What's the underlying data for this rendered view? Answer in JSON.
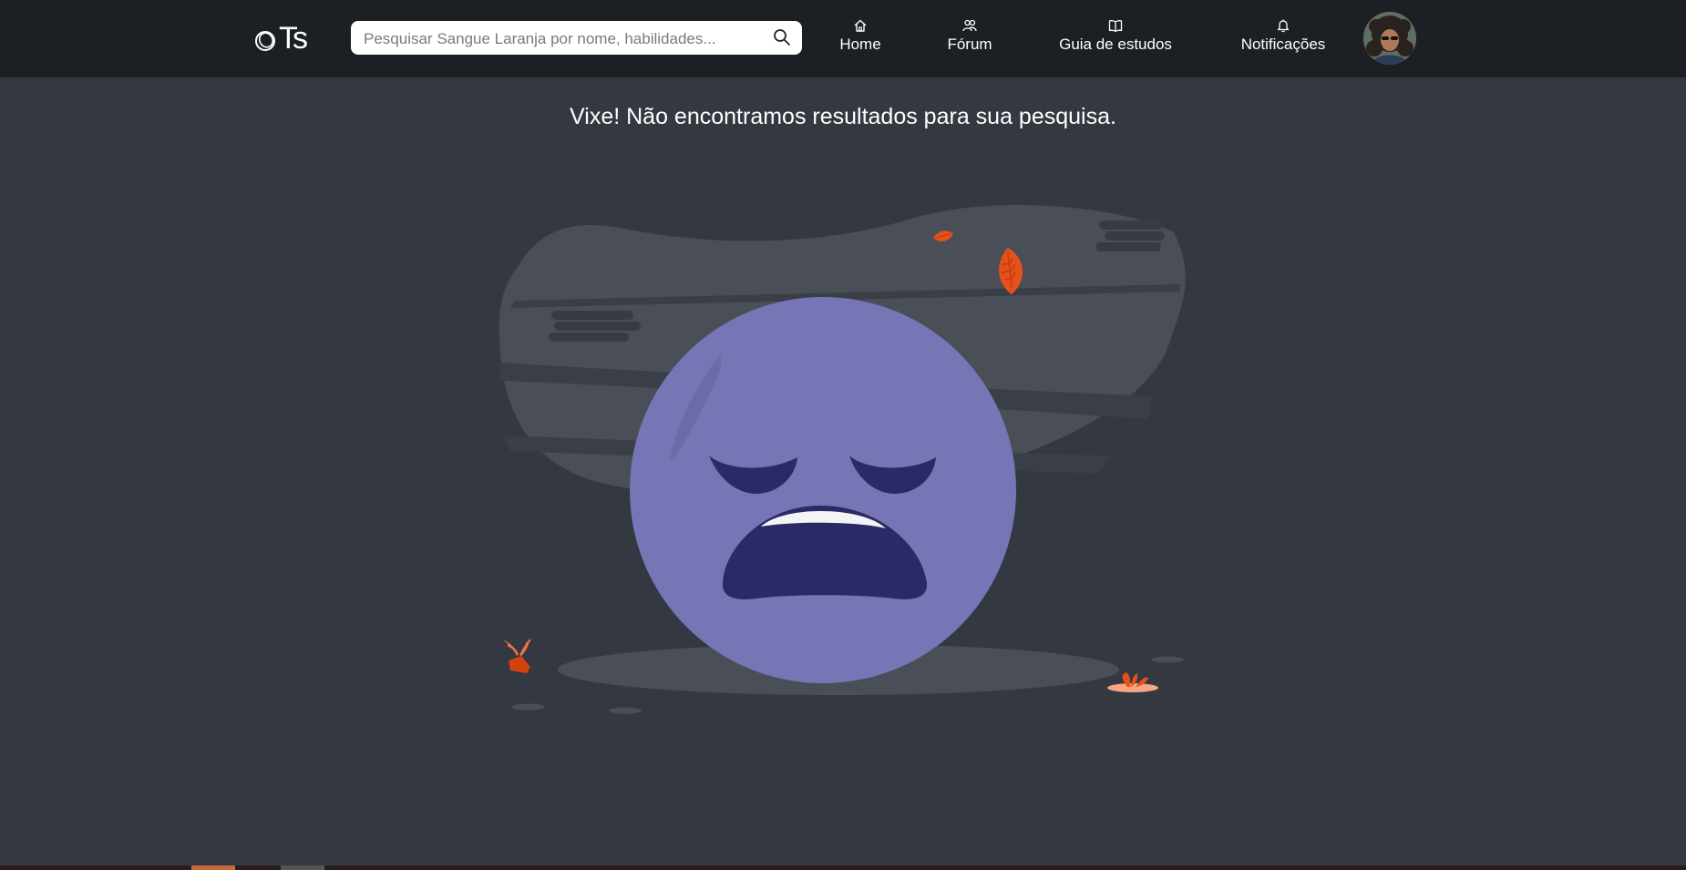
{
  "header": {
    "logo_text": "Ts",
    "search": {
      "placeholder": "Pesquisar Sangue Laranja por nome, habilidades...",
      "value": ""
    },
    "nav": [
      {
        "label": "Home",
        "icon": "home-icon"
      },
      {
        "label": "Fórum",
        "icon": "users-icon"
      },
      {
        "label": "Guia de estudos",
        "icon": "book-icon"
      },
      {
        "label": "Notificações",
        "icon": "bell-icon"
      }
    ]
  },
  "main": {
    "empty_message": "Vixe! Não encontramos resultados para sua pesquisa."
  },
  "colors": {
    "topbar": "#1c1f23",
    "background": "#343840",
    "emoji_face": "#7676b6",
    "emoji_features": "#2b2a66",
    "leaf_orange": "#e8501a"
  }
}
